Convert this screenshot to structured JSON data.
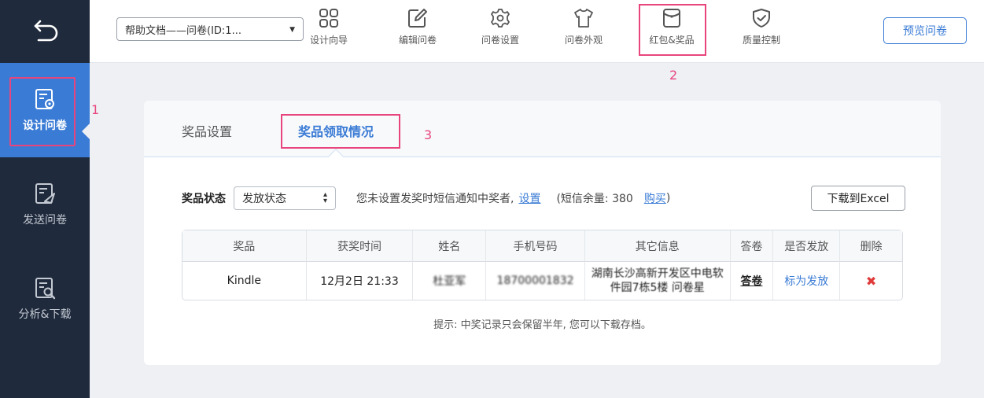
{
  "sidebar": {
    "items": [
      {
        "label": "设计问卷",
        "icon": "design-survey-icon",
        "active": true
      },
      {
        "label": "发送问卷",
        "icon": "send-survey-icon"
      },
      {
        "label": "分析&下载",
        "icon": "analyze-download-icon"
      }
    ]
  },
  "topbar": {
    "survey_select": "帮助文档——问卷(ID:1...",
    "tools": [
      {
        "label": "设计向导",
        "icon": "wizard-icon"
      },
      {
        "label": "编辑问卷",
        "icon": "edit-icon"
      },
      {
        "label": "问卷设置",
        "icon": "settings-icon"
      },
      {
        "label": "问卷外观",
        "icon": "shirt-icon"
      },
      {
        "label": "红包&奖品",
        "icon": "red-packet-icon"
      },
      {
        "label": "质量控制",
        "icon": "shield-check-icon"
      }
    ],
    "preview_label": "预览问卷"
  },
  "annotations": [
    "1",
    "2",
    "3"
  ],
  "tabs": [
    {
      "label": "奖品设置"
    },
    {
      "label": "奖品领取情况",
      "active": true
    }
  ],
  "filter": {
    "label": "奖品状态",
    "select_value": "发放状态",
    "notice_prefix": "您未设置发奖时短信通知中奖者,",
    "settings_link": "设置",
    "sms_prefix": "(短信余量: 380",
    "buy_link": "购买",
    "sms_suffix": ")",
    "excel_label": "下载到Excel"
  },
  "table": {
    "headers": [
      "奖品",
      "获奖时间",
      "姓名",
      "手机号码",
      "其它信息",
      "答卷",
      "是否发放",
      "删除"
    ],
    "rows": [
      {
        "prize": "Kindle",
        "time": "12月2日 21:33",
        "name": "杜亚军",
        "phone": "18700001832",
        "other": "湖南长沙高新开发区中电软件园7栋5楼 问卷星",
        "answer": "答卷",
        "issue": "标为发放",
        "delete": "✖"
      }
    ]
  },
  "tip": "提示: 中奖记录只会保留半年, 您可以下载存档。",
  "colors": {
    "accent": "#3a7bd5",
    "sidebar": "#1f2a3c",
    "highlight": "#e8457d"
  }
}
